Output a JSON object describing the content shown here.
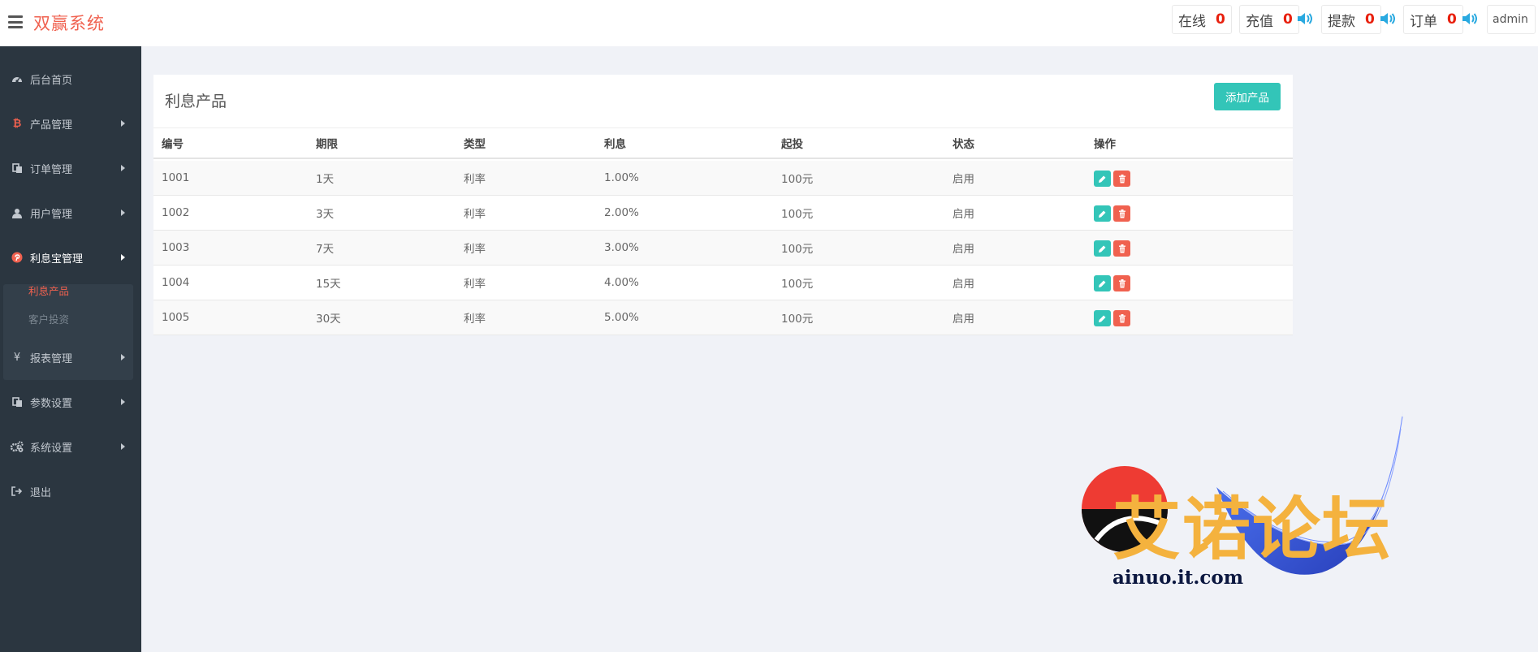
{
  "header": {
    "brand": "双赢系统",
    "stats": [
      {
        "label": "在线",
        "value": "0"
      },
      {
        "label": "充值",
        "value": "0"
      },
      {
        "label": "提款",
        "value": "0"
      },
      {
        "label": "订单",
        "value": "0"
      }
    ],
    "user": "admin"
  },
  "sidebar": {
    "items": [
      {
        "label": "后台首页",
        "icon": "dashboard-icon"
      },
      {
        "label": "产品管理",
        "icon": "bitcoin-icon"
      },
      {
        "label": "订单管理",
        "icon": "copy-icon"
      },
      {
        "label": "用户管理",
        "icon": "user-icon"
      },
      {
        "label": "利息宝管理",
        "icon": "pinterest-icon"
      },
      {
        "label": "报表管理",
        "icon": "yen-icon"
      },
      {
        "label": "参数设置",
        "icon": "copy-icon"
      },
      {
        "label": "系统设置",
        "icon": "cogs-icon"
      },
      {
        "label": "退出",
        "icon": "sign-out-icon"
      }
    ],
    "subitems": [
      {
        "label": "利息产品"
      },
      {
        "label": "客户投资"
      }
    ]
  },
  "panel": {
    "title": "利息产品",
    "add_label": "添加产品",
    "columns": [
      "编号",
      "期限",
      "类型",
      "利息",
      "起投",
      "状态",
      "操作"
    ],
    "rows": [
      {
        "id": "1001",
        "term": "1天",
        "type": "利率",
        "rate": "1.00%",
        "min": "100元",
        "status": "启用"
      },
      {
        "id": "1002",
        "term": "3天",
        "type": "利率",
        "rate": "2.00%",
        "min": "100元",
        "status": "启用"
      },
      {
        "id": "1003",
        "term": "7天",
        "type": "利率",
        "rate": "3.00%",
        "min": "100元",
        "status": "启用"
      },
      {
        "id": "1004",
        "term": "15天",
        "type": "利率",
        "rate": "4.00%",
        "min": "100元",
        "status": "启用"
      },
      {
        "id": "1005",
        "term": "30天",
        "type": "利率",
        "rate": "5.00%",
        "min": "100元",
        "status": "启用"
      }
    ]
  },
  "watermark": {
    "text": "艾诺论坛",
    "url": "ainuo.it.com"
  },
  "colors": {
    "brand": "#f0614f",
    "sidebar": "#2b3640",
    "accent": "#33c5b8",
    "danger": "#f0614f"
  }
}
